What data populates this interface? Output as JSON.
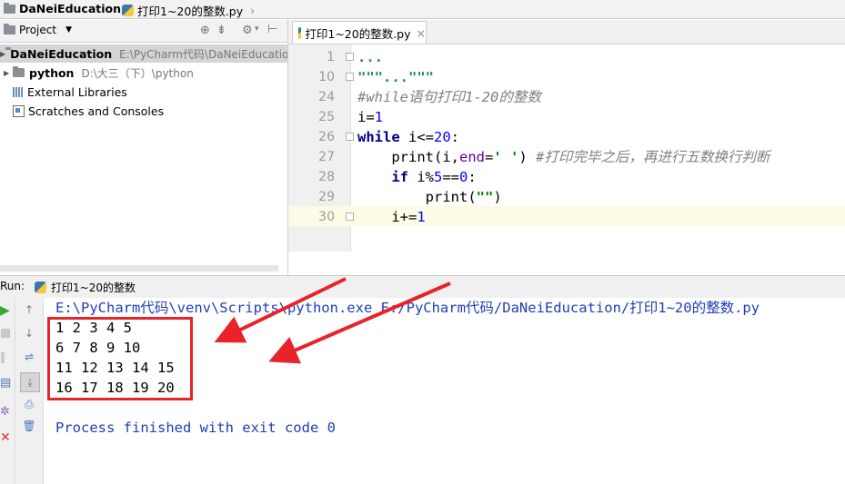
{
  "breadcrumb": {
    "project": "DaNeiEducation",
    "file": "打印1~20的整数.py"
  },
  "project_panel": {
    "title": "Project",
    "items": [
      {
        "name": "DaNeiEducation",
        "path": "E:\\PyCharm代码\\DaNeiEducatio"
      },
      {
        "name": "python",
        "path": "D:\\大三（下）\\python"
      },
      {
        "name": "External Libraries",
        "path": ""
      },
      {
        "name": "Scratches and Consoles",
        "path": ""
      }
    ]
  },
  "editor": {
    "tab_label": "打印1~20的整数.py",
    "tab_close": "×",
    "lines": [
      {
        "num": "1",
        "text": "..."
      },
      {
        "num": "10",
        "text": "\"\"\"...\"\"\""
      },
      {
        "num": "24",
        "text": "#while语句打印1-20的整数"
      },
      {
        "num": "25",
        "text": "i=1"
      },
      {
        "num": "26",
        "text": "while i<=20:"
      },
      {
        "num": "27",
        "text": "    print(i,end=' ') #打印完毕之后，再进行五数换行判断"
      },
      {
        "num": "28",
        "text": "    if i%5==0:"
      },
      {
        "num": "29",
        "text": "        print(\"\")"
      },
      {
        "num": "30",
        "text": "    i+=1"
      }
    ]
  },
  "run_panel": {
    "label": "Run:",
    "tab_label": "打印1~20的整数",
    "command": "E:\\PyCharm代码\\venv\\Scripts\\python.exe E:/PyCharm代码/DaNeiEducation/打印1~20的整数.py",
    "output": [
      "1 2 3 4 5",
      "6 7 8 9 10",
      "11 12 13 14 15",
      "16 17 18 19 20"
    ],
    "exit_message": "Process finished with exit code 0"
  },
  "colors": {
    "keyword": "#000080",
    "number": "#0000ff",
    "comment": "#808080",
    "console_text": "#1f3fb8",
    "annotation_red": "#e8232a",
    "run_green": "#3aa63a"
  }
}
